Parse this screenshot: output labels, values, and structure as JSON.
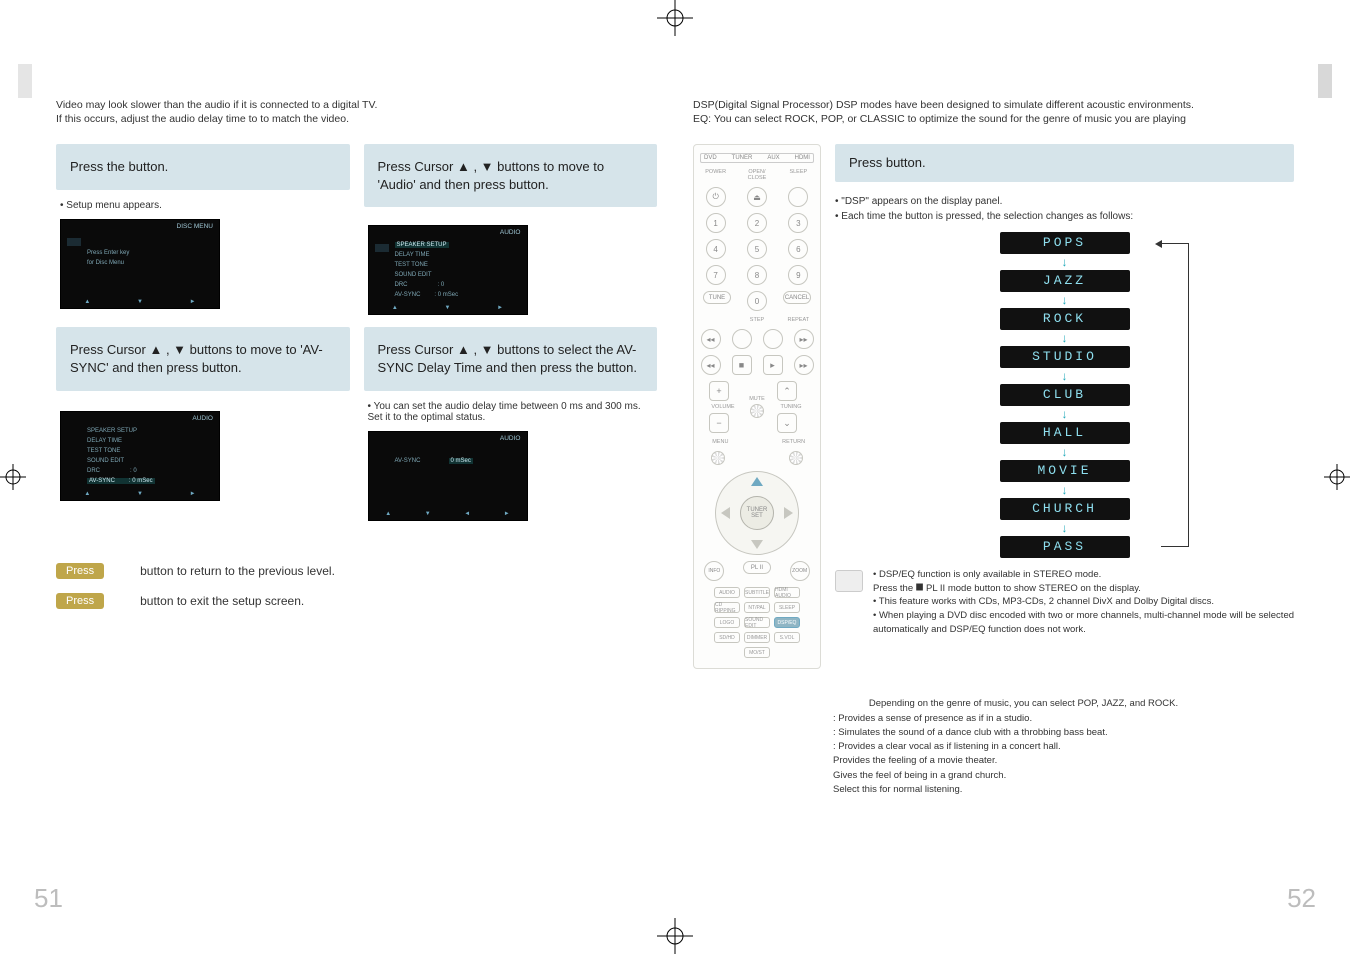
{
  "left": {
    "intro_line1": "Video may look slower than the audio if it is connected to a digital TV.",
    "intro_line2": "If this occurs, adjust the audio delay time to to match the video.",
    "steps": {
      "s1": {
        "text_a": "Press the ",
        "text_b": " button."
      },
      "s1_note": "Setup menu appears.",
      "s2": {
        "text_a": "Press Cursor ▲ , ▼  buttons to move to 'Audio' and then press ",
        "text_b": " button."
      },
      "s3": {
        "text_a": "Press Cursor ▲ , ▼   buttons to move to 'AV-SYNC' and then press ",
        "text_b": " button."
      },
      "s4": {
        "text_a": "Press Cursor ▲ , ▼   buttons to select the AV-SYNC Delay Time  and then press the ",
        "text_b": " button."
      },
      "s4_note": "You can set the audio delay time between 0 ms and 300 ms. Set it to the optimal status."
    },
    "osd": {
      "title_right": "DISC MENU",
      "title_audio": "AUDIO",
      "items": [
        "SPEAKER SETUP",
        "DELAY TIME",
        "TEST TONE",
        "SOUND EDIT",
        "DRC",
        "AV-SYNC"
      ],
      "drc_val": ": 0",
      "avsync_sel": ": 0 mSec",
      "step1_line1": "Press Enter key",
      "step1_line2": "for Disc Menu",
      "nav": [
        "▲",
        "▼",
        "◄",
        "►"
      ]
    },
    "footer": {
      "pill1": "Press",
      "text1": " button to return to the previous level.",
      "pill2": "Press",
      "text2": " button to exit the setup screen."
    },
    "pagenum": "51"
  },
  "right": {
    "intro_line1": "DSP(Digital Signal Processor) DSP modes have been designed to simulate different acoustic environments.",
    "intro_line2": "EQ: You can select ROCK, POP, or CLASSIC to optimize the sound for the genre of music you are playing",
    "step1": {
      "text_a": "Press ",
      "text_b": " button."
    },
    "bullet1": "\"DSP\" appears on the display panel.",
    "bullet2": "Each time the button is pressed, the selection changes as follows:",
    "modes": [
      "POPS",
      "JAZZ",
      "ROCK",
      "STUDIO",
      "CLUB",
      "HALL",
      "MOVIE",
      "CHURCH",
      "PASS"
    ],
    "notes": {
      "n1": "DSP/EQ function is only available in STEREO mode.",
      "n1b": "Press the  ⯀  PL II mode button to show STEREO on the display.",
      "n2": "This feature works with CDs, MP3-CDs, 2 channel DivX and Dolby Digital discs.",
      "n3": "When playing a DVD disc encoded with two or more channels, multi-channel mode will be selected automatically and DSP/EQ function does not work."
    },
    "defs": {
      "d1": "Depending on the genre of music, you can select POP, JAZZ, and ROCK.",
      "d2": ": Provides a sense of presence as if in a studio.",
      "d3": ": Simulates the sound of a dance club with a throbbing bass beat.",
      "d4": ": Provides a clear vocal as if listening in a concert hall.",
      "d5": "Provides the feeling of a movie theater.",
      "d6": "Gives the feel of being in a grand church.",
      "d7": "Select this for normal listening."
    },
    "remote": {
      "top": {
        "dvd": "DVD",
        "tuner": "TUNER",
        "aux": "AUX",
        "hdmi": "HDMI"
      },
      "row1": {
        "power": "POWER",
        "open": "OPEN/\nCLOSE",
        "sleep": "SLEEP"
      },
      "tune": "TUNE",
      "cancel": "CANCEL",
      "step": "STEP",
      "repeat": "REPEAT",
      "mute": "MUTE",
      "tuning": "TUNING",
      "volume": "VOLUME",
      "menu": "MENU",
      "return": "RETURN",
      "enter": "TUNER\nSET",
      "info": "INFO",
      "plii": "PL II",
      "zoom": "ZOOM",
      "btns": [
        "AUDIO",
        "SUBTITLE",
        "HDMI AUDIO",
        "CD RIPPING",
        "NT/PAL",
        "SLEEP",
        "LOGO",
        "SOUND EDIT",
        "DSP/EQ",
        "SD/HD",
        "DIMMER",
        "S.VOL",
        "MO/ST"
      ],
      "dspeq": "DSP/EQ",
      "dimmer": "DIMMER"
    },
    "pagenum": "52"
  }
}
